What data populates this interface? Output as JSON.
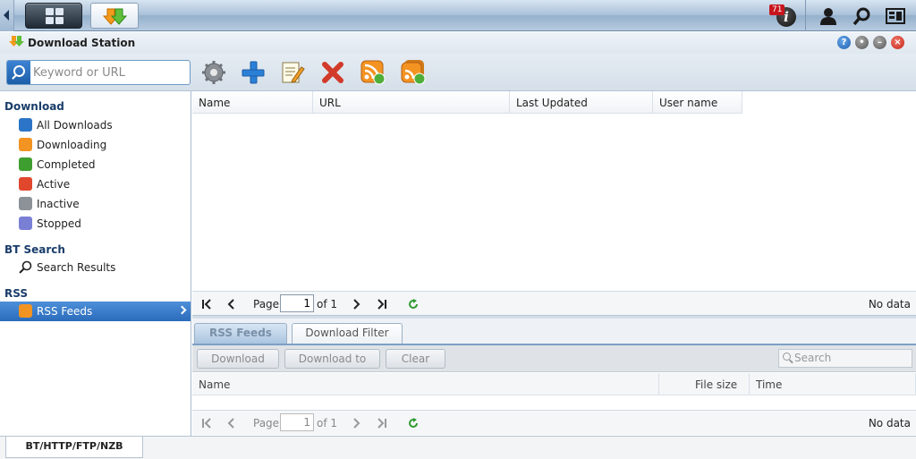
{
  "taskbar": {
    "notification_count": "71"
  },
  "window": {
    "title": "Download Station"
  },
  "toolbar": {
    "search_placeholder": "Keyword or URL"
  },
  "sidebar": {
    "download_header": "Download",
    "download_items": [
      {
        "label": "All Downloads",
        "icon": "list-icon"
      },
      {
        "label": "Downloading",
        "icon": "download-arrow-icon"
      },
      {
        "label": "Completed",
        "icon": "check-icon"
      },
      {
        "label": "Active",
        "icon": "active-icon"
      },
      {
        "label": "Inactive",
        "icon": "inactive-icon"
      },
      {
        "label": "Stopped",
        "icon": "pause-icon"
      }
    ],
    "bt_header": "BT Search",
    "bt_items": [
      {
        "label": "Search Results",
        "icon": "magnifier-icon"
      }
    ],
    "rss_header": "RSS",
    "rss_items": [
      {
        "label": "RSS Feeds",
        "icon": "rss-icon",
        "selected": true
      }
    ]
  },
  "feeds_table": {
    "columns": [
      "Name",
      "URL",
      "Last Updated",
      "User name"
    ],
    "pager": {
      "page_label": "Page",
      "page_value": "1",
      "of_label": "of 1",
      "status": "No data"
    }
  },
  "detail": {
    "tabs": [
      {
        "label": "RSS Feeds",
        "active": true
      },
      {
        "label": "Download Filter",
        "active": false
      }
    ],
    "buttons": [
      "Download",
      "Download to",
      "Clear"
    ],
    "search_placeholder": "Search",
    "columns": [
      "Name",
      "File size",
      "Time"
    ],
    "pager": {
      "page_label": "Page",
      "page_value": "1",
      "of_label": "of 1",
      "status": "No data"
    }
  },
  "bottom": {
    "tab_label": "BT/HTTP/FTP/NZB"
  },
  "colors": {
    "accent": "#2a6cbb",
    "taskbar": "#a9c0d8",
    "close": "#d23a2a"
  }
}
